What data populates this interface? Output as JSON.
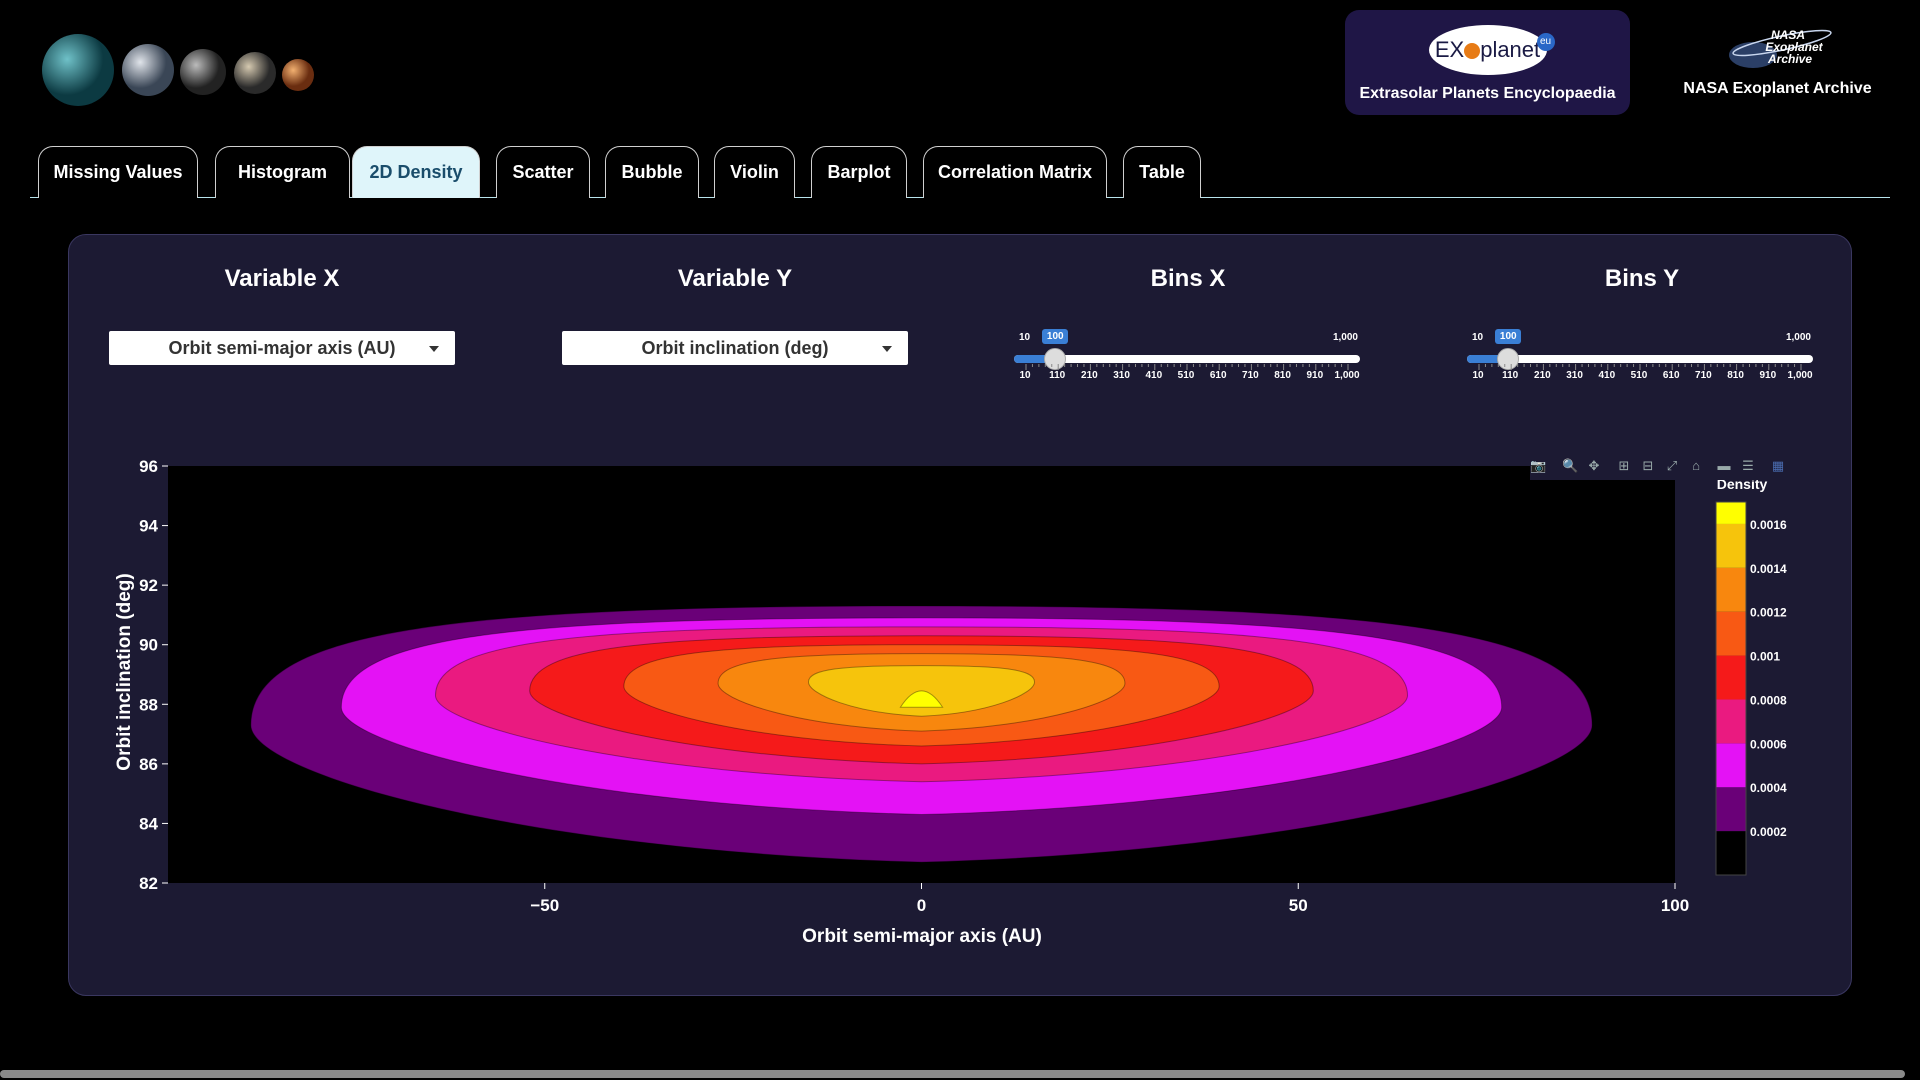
{
  "header": {
    "exoplanet_logo": {
      "text_left": "EX",
      "text_right": "planet",
      "badge": "eu",
      "caption": "Extrasolar Planets Encyclopaedia"
    },
    "nasa_logo": {
      "lines": [
        "NASA",
        "Exoplanet",
        "Archive"
      ],
      "caption": "NASA Exoplanet Archive"
    }
  },
  "tabs": [
    {
      "label": "Missing Values",
      "active": false
    },
    {
      "label": "Histogram",
      "active": false
    },
    {
      "label": "2D Density",
      "active": true
    },
    {
      "label": "Scatter",
      "active": false
    },
    {
      "label": "Bubble",
      "active": false
    },
    {
      "label": "Violin",
      "active": false
    },
    {
      "label": "Barplot",
      "active": false
    },
    {
      "label": "Correlation Matrix",
      "active": false
    },
    {
      "label": "Table",
      "active": false
    }
  ],
  "controls": {
    "variable_x": {
      "title": "Variable X",
      "value": "Orbit semi-major axis (AU)"
    },
    "variable_y": {
      "title": "Variable Y",
      "value": "Orbit inclination (deg)"
    },
    "bins_x": {
      "title": "Bins X",
      "min_label": "10",
      "max_label": "1,000",
      "value": "100",
      "value_num": 100,
      "min": 10,
      "max": 1000,
      "tick_labels": [
        "10",
        "110",
        "210",
        "310",
        "410",
        "510",
        "610",
        "710",
        "810",
        "910",
        "1,000"
      ]
    },
    "bins_y": {
      "title": "Bins Y",
      "min_label": "10",
      "max_label": "1,000",
      "value": "100",
      "value_num": 100,
      "min": 10,
      "max": 1000,
      "tick_labels": [
        "10",
        "110",
        "210",
        "310",
        "410",
        "510",
        "610",
        "710",
        "810",
        "910",
        "1,000"
      ]
    }
  },
  "modebar": [
    "camera-icon",
    "zoom-icon",
    "pan-icon",
    "zoom-in-icon",
    "zoom-out-icon",
    "autoscale-icon",
    "reset-axes-icon",
    "spike-lines-icon",
    "compare-data-icon",
    "plotly-logo-icon"
  ],
  "chart_data": {
    "type": "contour",
    "xlabel": "Orbit semi-major axis (AU)",
    "ylabel": "Orbit inclination (deg)",
    "xlim": [
      -100,
      100
    ],
    "ylim": [
      82,
      96
    ],
    "x_ticks": [
      -50,
      0,
      50,
      100
    ],
    "x_tick_labels": [
      "−50",
      "0",
      "50",
      "100"
    ],
    "y_ticks": [
      82,
      84,
      86,
      88,
      90,
      92,
      94,
      96
    ],
    "y_tick_labels": [
      "82",
      "84",
      "86",
      "88",
      "90",
      "92",
      "94",
      "96"
    ],
    "peak": {
      "x": 0,
      "y": 88.3
    },
    "colorbar": {
      "title": "Density",
      "tick_labels": [
        "0.0002",
        "0.0004",
        "0.0006",
        "0.0008",
        "0.001",
        "0.0012",
        "0.0014",
        "0.0016"
      ],
      "tick_values": [
        0.0002,
        0.0004,
        0.0006,
        0.0008,
        0.001,
        0.0012,
        0.0014,
        0.0016
      ],
      "levels": [
        {
          "min": 0,
          "max": 0.0002,
          "color": "#000000"
        },
        {
          "min": 0.0002,
          "max": 0.0004,
          "color": "#6a0078"
        },
        {
          "min": 0.0004,
          "max": 0.0006,
          "color": "#e412f5"
        },
        {
          "min": 0.0006,
          "max": 0.0008,
          "color": "#ea1a80"
        },
        {
          "min": 0.0008,
          "max": 0.001,
          "color": "#f51a1a"
        },
        {
          "min": 0.001,
          "max": 0.0012,
          "color": "#f85914"
        },
        {
          "min": 0.0012,
          "max": 0.0014,
          "color": "#f8870e"
        },
        {
          "min": 0.0014,
          "max": 0.0016,
          "color": "#f6c40c"
        },
        {
          "min": 0.0016,
          "max": 0.0017,
          "color": "#ffff00"
        }
      ]
    },
    "contours": [
      {
        "level": 0.0002,
        "x_half_width": 89,
        "y_top": 91.3,
        "y_bottom": 82.7,
        "color": "#6a0078"
      },
      {
        "level": 0.0004,
        "x_half_width": 77,
        "y_top": 90.9,
        "y_bottom": 84.3,
        "color": "#e412f5"
      },
      {
        "level": 0.0006,
        "x_half_width": 64.5,
        "y_top": 90.6,
        "y_bottom": 85.4,
        "color": "#ea1a80"
      },
      {
        "level": 0.0008,
        "x_half_width": 52,
        "y_top": 90.3,
        "y_bottom": 86.0,
        "color": "#f51a1a"
      },
      {
        "level": 0.001,
        "x_half_width": 39.5,
        "y_top": 90.0,
        "y_bottom": 86.6,
        "color": "#f85914"
      },
      {
        "level": 0.0012,
        "x_half_width": 27,
        "y_top": 89.7,
        "y_bottom": 87.1,
        "color": "#f8870e"
      },
      {
        "level": 0.0014,
        "x_half_width": 15,
        "y_top": 89.3,
        "y_bottom": 87.6,
        "color": "#f6c40c"
      },
      {
        "level": 0.0016,
        "x_half_width": 2.8,
        "y_top": 88.8,
        "y_bottom": 87.9,
        "color": "#ffff00"
      }
    ]
  }
}
